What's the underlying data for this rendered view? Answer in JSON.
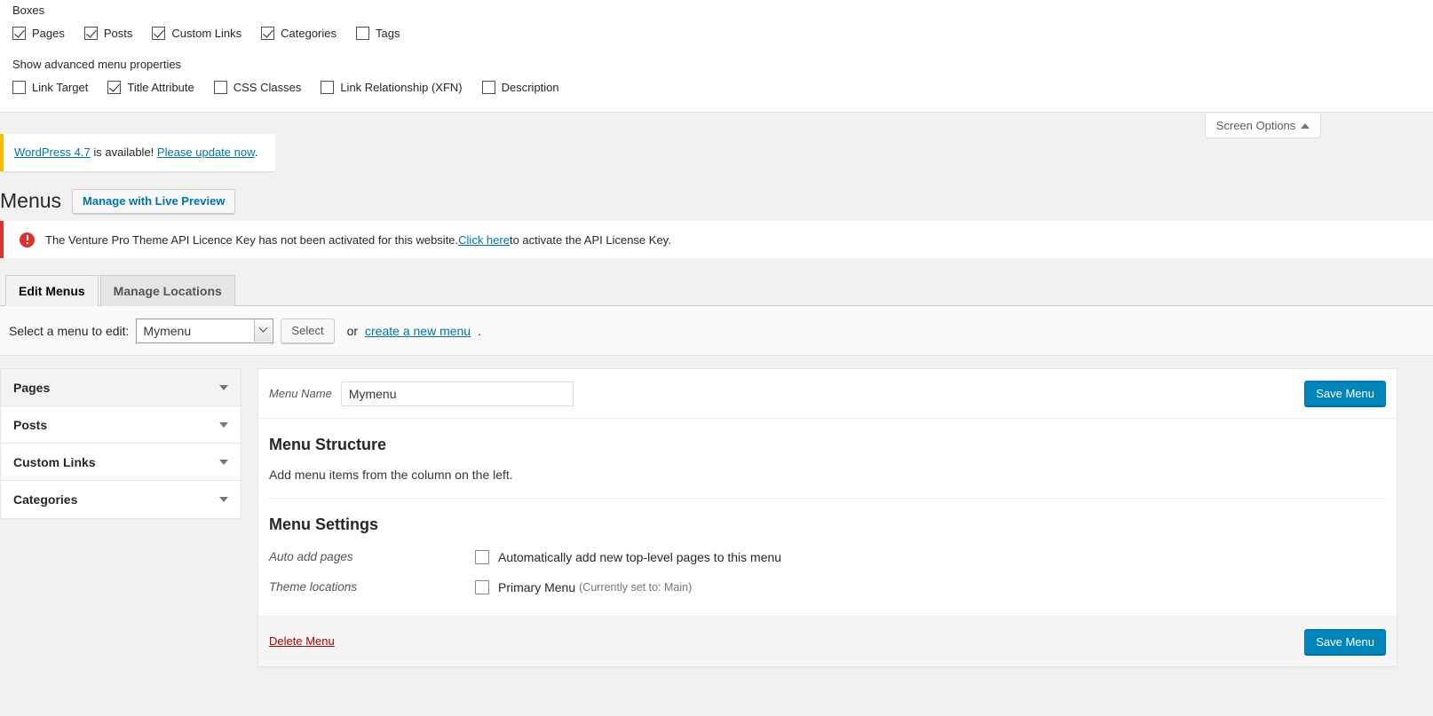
{
  "screen_options": {
    "boxes_legend": "Boxes",
    "boxes": [
      {
        "label": "Pages",
        "checked": true
      },
      {
        "label": "Posts",
        "checked": true
      },
      {
        "label": "Custom Links",
        "checked": true
      },
      {
        "label": "Categories",
        "checked": true
      },
      {
        "label": "Tags",
        "checked": false
      }
    ],
    "advanced_legend": "Show advanced menu properties",
    "advanced": [
      {
        "label": "Link Target",
        "checked": false
      },
      {
        "label": "Title Attribute",
        "checked": true
      },
      {
        "label": "CSS Classes",
        "checked": false
      },
      {
        "label": "Link Relationship (XFN)",
        "checked": false
      },
      {
        "label": "Description",
        "checked": false
      }
    ],
    "tab_label": "Screen Options",
    "tab_icon": "caret-up-icon"
  },
  "update_notice": {
    "version_link": "WordPress 4.7",
    "text_middle": " is available! ",
    "update_link": "Please update now",
    "text_end": ".",
    "accent_color": "#ffb900"
  },
  "header": {
    "title": "Menus",
    "live_preview_button": "Manage with Live Preview"
  },
  "error_notice": {
    "icon": "error-circle-icon",
    "text_before": "The Venture Pro Theme API Licence Key has not been activated for this website. ",
    "link": "Click here",
    "text_after": " to activate the API License Key.",
    "accent_color": "#dc3232"
  },
  "tabs": [
    {
      "label": "Edit Menus",
      "active": true
    },
    {
      "label": "Manage Locations",
      "active": false
    }
  ],
  "menu_selector": {
    "label": "Select a menu to edit:",
    "selected": "Mymenu",
    "select_button": "Select",
    "or_text": "or ",
    "create_link": "create a new menu",
    "period": "."
  },
  "sidebar": {
    "panels": [
      {
        "label": "Pages",
        "icon": "triangle-down-icon"
      },
      {
        "label": "Posts",
        "icon": "triangle-down-icon"
      },
      {
        "label": "Custom Links",
        "icon": "triangle-down-icon"
      },
      {
        "label": "Categories",
        "icon": "triangle-down-icon"
      }
    ]
  },
  "main": {
    "menu_name_label": "Menu Name",
    "menu_name_value": "Mymenu",
    "menu_name_placeholder": "Menu Name",
    "save_menu_top": "Save Menu",
    "structure_heading": "Menu Structure",
    "structure_hint": "Add menu items from the column on the left.",
    "settings_heading": "Menu Settings",
    "auto_add_label": "Auto add pages",
    "auto_add_checkbox_label": "Automatically add new top-level pages to this menu",
    "auto_add_checked": false,
    "theme_locations_label": "Theme locations",
    "primary_menu_label": "Primary Menu",
    "primary_menu_note": "(Currently set to: Main)",
    "primary_menu_checked": false,
    "delete_menu": "Delete Menu",
    "save_menu_bottom": "Save Menu",
    "primary_color": "#0085ba"
  }
}
